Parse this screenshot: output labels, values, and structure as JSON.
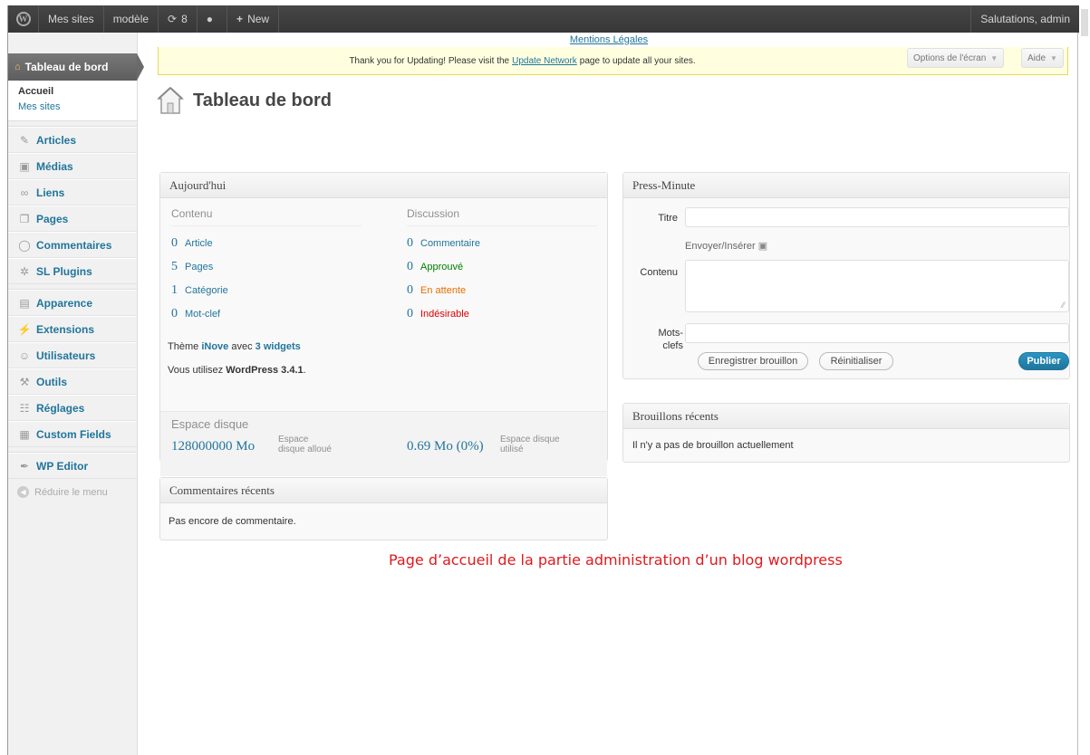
{
  "adminbar": {
    "my_sites": "Mes sites",
    "site_name": "modèle",
    "updates_count": "8",
    "new_label": "New",
    "greeting": "Salutations, admin"
  },
  "sidebar": {
    "current": "Tableau de bord",
    "submenu": [
      "Accueil",
      "Mes sites"
    ],
    "items": [
      {
        "label": "Articles",
        "icon": "pushpin-icon"
      },
      {
        "label": "Médias",
        "icon": "media-icon"
      },
      {
        "label": "Liens",
        "icon": "link-icon"
      },
      {
        "label": "Pages",
        "icon": "pages-icon"
      },
      {
        "label": "Commentaires",
        "icon": "comment-icon"
      },
      {
        "label": "SL Plugins",
        "icon": "gear-icon"
      },
      {
        "label": "Apparence",
        "icon": "appearance-icon"
      },
      {
        "label": "Extensions",
        "icon": "plugin-icon"
      },
      {
        "label": "Utilisateurs",
        "icon": "users-icon"
      },
      {
        "label": "Outils",
        "icon": "tools-icon"
      },
      {
        "label": "Réglages",
        "icon": "settings-icon"
      },
      {
        "label": "Custom Fields",
        "icon": "fields-icon"
      },
      {
        "label": "WP Editor",
        "icon": "pen-icon"
      }
    ],
    "collapse": "Réduire le menu"
  },
  "header": {
    "mentions": "Mentions Légales",
    "notice_before": "Thank you for Updating! Please visit the",
    "notice_link": "Update Network",
    "notice_after": "page to update all your sites.",
    "screen_options": "Options de l'écran",
    "help": "Aide",
    "page_title": "Tableau de bord"
  },
  "today": {
    "title": "Aujourd'hui",
    "content_head": "Contenu",
    "discussion_head": "Discussion",
    "content_rows": [
      {
        "num": "0",
        "label": "Article"
      },
      {
        "num": "5",
        "label": "Pages"
      },
      {
        "num": "1",
        "label": "Catégorie"
      },
      {
        "num": "0",
        "label": "Mot-clef"
      }
    ],
    "discussion_rows": [
      {
        "num": "0",
        "label": "Commentaire"
      },
      {
        "num": "0",
        "label": "Approuvé"
      },
      {
        "num": "0",
        "label": "En attente"
      },
      {
        "num": "0",
        "label": "Indésirable"
      }
    ],
    "theme_prefix": "Thème",
    "theme_name": "iNove",
    "theme_mid": "avec",
    "widgets": "3 widgets",
    "version_prefix": "Vous utilisez",
    "version": "WordPress 3.4.1",
    "version_suffix": ".",
    "disk_title": "Espace disque",
    "disk_allowed_value": "128000000 Mo",
    "disk_allowed_label_1": "Espace",
    "disk_allowed_label_2": "disque alloué",
    "disk_used_value": "0.69 Mo (0%)",
    "disk_used_label_1": "Espace disque",
    "disk_used_label_2": "utilisé"
  },
  "recent_comments": {
    "title": "Commentaires récents",
    "empty": "Pas encore de commentaire."
  },
  "press": {
    "title": "Press-Minute",
    "title_label": "Titre",
    "upload_label": "Envoyer/Insérer",
    "content_label": "Contenu",
    "tags_label_1": "Mots-",
    "tags_label_2": "clefs",
    "save_draft": "Enregistrer brouillon",
    "reset": "Réinitialiser",
    "publish": "Publier"
  },
  "drafts": {
    "title": "Brouillons récents",
    "empty": "Il n'y a pas de brouillon actuellement"
  },
  "caption": "Page d’accueil de la partie administration d’un blog wordpress",
  "colors": {
    "link": "#21759b",
    "caption": "#e0191d",
    "adminbar": "#464646"
  }
}
